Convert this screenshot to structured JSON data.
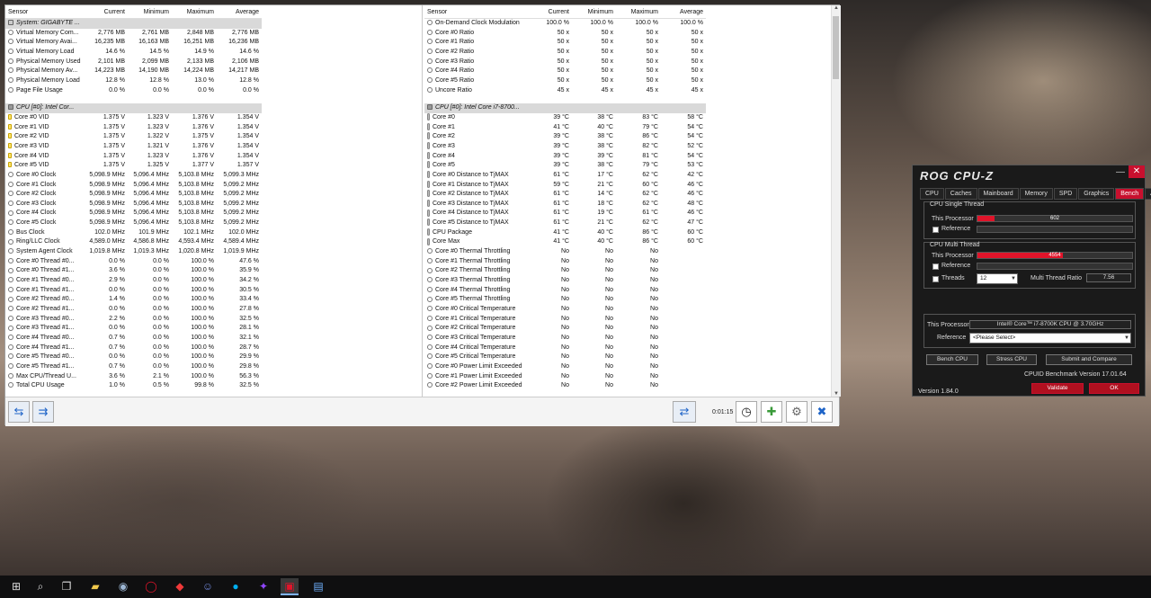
{
  "hwinfo": {
    "columns": [
      "Sensor",
      "Current",
      "Minimum",
      "Maximum",
      "Average"
    ],
    "left_rows": [
      {
        "g": 1,
        "icon": "sys-icon",
        "name": "System: GIGABYTE ..."
      },
      {
        "icon": "circle-icon",
        "name": "Virtual Memory Com...",
        "cur": "2,776 MB",
        "min": "2,761 MB",
        "max": "2,848 MB",
        "avg": "2,776 MB"
      },
      {
        "icon": "circle-icon",
        "name": "Virtual Memory Avai...",
        "cur": "16,235 MB",
        "min": "16,163 MB",
        "max": "16,251 MB",
        "avg": "16,236 MB"
      },
      {
        "icon": "circle-icon",
        "name": "Virtual Memory Load",
        "cur": "14.6 %",
        "min": "14.5 %",
        "max": "14.9 %",
        "avg": "14.6 %"
      },
      {
        "icon": "circle-icon",
        "name": "Physical Memory Used",
        "cur": "2,101 MB",
        "min": "2,099 MB",
        "max": "2,133 MB",
        "avg": "2,106 MB"
      },
      {
        "icon": "circle-icon",
        "name": "Physical Memory Av...",
        "cur": "14,223 MB",
        "min": "14,190 MB",
        "max": "14,224 MB",
        "avg": "14,217 MB"
      },
      {
        "icon": "circle-icon",
        "name": "Physical Memory Load",
        "cur": "12.8 %",
        "min": "12.8 %",
        "max": "13.0 %",
        "avg": "12.8 %"
      },
      {
        "icon": "circle-icon",
        "name": "Page File Usage",
        "cur": "0.0 %",
        "min": "0.0 %",
        "max": "0.0 %",
        "avg": "0.0 %"
      },
      {
        "spacer": 1
      },
      {
        "g": 1,
        "icon": "cpu-icon",
        "name": "CPU [#0]: Intel Cor..."
      },
      {
        "icon": "voltage-icon",
        "name": "Core #0 VID",
        "cur": "1.375 V",
        "min": "1.323 V",
        "max": "1.376 V",
        "avg": "1.354 V"
      },
      {
        "icon": "voltage-icon",
        "name": "Core #1 VID",
        "cur": "1.375 V",
        "min": "1.323 V",
        "max": "1.376 V",
        "avg": "1.354 V"
      },
      {
        "icon": "voltage-icon",
        "name": "Core #2 VID",
        "cur": "1.375 V",
        "min": "1.322 V",
        "max": "1.375 V",
        "avg": "1.354 V"
      },
      {
        "icon": "voltage-icon",
        "name": "Core #3 VID",
        "cur": "1.375 V",
        "min": "1.321 V",
        "max": "1.376 V",
        "avg": "1.354 V"
      },
      {
        "icon": "voltage-icon",
        "name": "Core #4 VID",
        "cur": "1.375 V",
        "min": "1.323 V",
        "max": "1.376 V",
        "avg": "1.354 V"
      },
      {
        "icon": "voltage-icon",
        "name": "Core #5 VID",
        "cur": "1.375 V",
        "min": "1.325 V",
        "max": "1.377 V",
        "avg": "1.357 V"
      },
      {
        "icon": "circle-icon",
        "name": "Core #0 Clock",
        "cur": "5,098.9 MHz",
        "min": "5,096.4 MHz",
        "max": "5,103.8 MHz",
        "avg": "5,099.3 MHz"
      },
      {
        "icon": "circle-icon",
        "name": "Core #1 Clock",
        "cur": "5,098.9 MHz",
        "min": "5,096.4 MHz",
        "max": "5,103.8 MHz",
        "avg": "5,099.2 MHz"
      },
      {
        "icon": "circle-icon",
        "name": "Core #2 Clock",
        "cur": "5,098.9 MHz",
        "min": "5,096.4 MHz",
        "max": "5,103.8 MHz",
        "avg": "5,099.2 MHz"
      },
      {
        "icon": "circle-icon",
        "name": "Core #3 Clock",
        "cur": "5,098.9 MHz",
        "min": "5,096.4 MHz",
        "max": "5,103.8 MHz",
        "avg": "5,099.2 MHz"
      },
      {
        "icon": "circle-icon",
        "name": "Core #4 Clock",
        "cur": "5,098.9 MHz",
        "min": "5,096.4 MHz",
        "max": "5,103.8 MHz",
        "avg": "5,099.2 MHz"
      },
      {
        "icon": "circle-icon",
        "name": "Core #5 Clock",
        "cur": "5,098.9 MHz",
        "min": "5,096.4 MHz",
        "max": "5,103.8 MHz",
        "avg": "5,099.2 MHz"
      },
      {
        "icon": "circle-icon",
        "name": "Bus Clock",
        "cur": "102.0 MHz",
        "min": "101.9 MHz",
        "max": "102.1 MHz",
        "avg": "102.0 MHz"
      },
      {
        "icon": "circle-icon",
        "name": "Ring/LLC Clock",
        "cur": "4,589.0 MHz",
        "min": "4,586.8 MHz",
        "max": "4,593.4 MHz",
        "avg": "4,589.4 MHz"
      },
      {
        "icon": "circle-icon",
        "name": "System Agent Clock",
        "cur": "1,019.8 MHz",
        "min": "1,019.3 MHz",
        "max": "1,020.8 MHz",
        "avg": "1,019.9 MHz"
      },
      {
        "icon": "circle-icon",
        "name": "Core #0 Thread #0...",
        "cur": "0.0 %",
        "min": "0.0 %",
        "max": "100.0 %",
        "avg": "47.6 %"
      },
      {
        "icon": "circle-icon",
        "name": "Core #0 Thread #1...",
        "cur": "3.6 %",
        "min": "0.0 %",
        "max": "100.0 %",
        "avg": "35.9 %"
      },
      {
        "icon": "circle-icon",
        "name": "Core #1 Thread #0...",
        "cur": "2.9 %",
        "min": "0.0 %",
        "max": "100.0 %",
        "avg": "34.2 %"
      },
      {
        "icon": "circle-icon",
        "name": "Core #1 Thread #1...",
        "cur": "0.0 %",
        "min": "0.0 %",
        "max": "100.0 %",
        "avg": "30.5 %"
      },
      {
        "icon": "circle-icon",
        "name": "Core #2 Thread #0...",
        "cur": "1.4 %",
        "min": "0.0 %",
        "max": "100.0 %",
        "avg": "33.4 %"
      },
      {
        "icon": "circle-icon",
        "name": "Core #2 Thread #1...",
        "cur": "0.0 %",
        "min": "0.0 %",
        "max": "100.0 %",
        "avg": "27.8 %"
      },
      {
        "icon": "circle-icon",
        "name": "Core #3 Thread #0...",
        "cur": "2.2 %",
        "min": "0.0 %",
        "max": "100.0 %",
        "avg": "32.5 %"
      },
      {
        "icon": "circle-icon",
        "name": "Core #3 Thread #1...",
        "cur": "0.0 %",
        "min": "0.0 %",
        "max": "100.0 %",
        "avg": "28.1 %"
      },
      {
        "icon": "circle-icon",
        "name": "Core #4 Thread #0...",
        "cur": "0.7 %",
        "min": "0.0 %",
        "max": "100.0 %",
        "avg": "32.1 %"
      },
      {
        "icon": "circle-icon",
        "name": "Core #4 Thread #1...",
        "cur": "0.7 %",
        "min": "0.0 %",
        "max": "100.0 %",
        "avg": "28.7 %"
      },
      {
        "icon": "circle-icon",
        "name": "Core #5 Thread #0...",
        "cur": "0.0 %",
        "min": "0.0 %",
        "max": "100.0 %",
        "avg": "29.9 %"
      },
      {
        "icon": "circle-icon",
        "name": "Core #5 Thread #1...",
        "cur": "0.7 %",
        "min": "0.0 %",
        "max": "100.0 %",
        "avg": "29.8 %"
      },
      {
        "icon": "circle-icon",
        "name": "Max CPU/Thread U...",
        "cur": "3.6 %",
        "min": "2.1 %",
        "max": "100.0 %",
        "avg": "56.3 %"
      },
      {
        "icon": "circle-icon",
        "name": "Total CPU Usage",
        "cur": "1.0 %",
        "min": "0.5 %",
        "max": "99.8 %",
        "avg": "32.5 %"
      }
    ],
    "right_rows": [
      {
        "icon": "circle-icon",
        "name": "On-Demand Clock Modulation",
        "cur": "100.0 %",
        "min": "100.0 %",
        "max": "100.0 %",
        "avg": "100.0 %"
      },
      {
        "icon": "circle-icon",
        "name": "Core #0 Ratio",
        "cur": "50 x",
        "min": "50 x",
        "max": "50 x",
        "avg": "50 x"
      },
      {
        "icon": "circle-icon",
        "name": "Core #1 Ratio",
        "cur": "50 x",
        "min": "50 x",
        "max": "50 x",
        "avg": "50 x"
      },
      {
        "icon": "circle-icon",
        "name": "Core #2 Ratio",
        "cur": "50 x",
        "min": "50 x",
        "max": "50 x",
        "avg": "50 x"
      },
      {
        "icon": "circle-icon",
        "name": "Core #3 Ratio",
        "cur": "50 x",
        "min": "50 x",
        "max": "50 x",
        "avg": "50 x"
      },
      {
        "icon": "circle-icon",
        "name": "Core #4 Ratio",
        "cur": "50 x",
        "min": "50 x",
        "max": "50 x",
        "avg": "50 x"
      },
      {
        "icon": "circle-icon",
        "name": "Core #5 Ratio",
        "cur": "50 x",
        "min": "50 x",
        "max": "50 x",
        "avg": "50 x"
      },
      {
        "icon": "circle-icon",
        "name": "Uncore Ratio",
        "cur": "45 x",
        "min": "45 x",
        "max": "45 x",
        "avg": "45 x"
      },
      {
        "spacer": 1
      },
      {
        "g": 1,
        "icon": "cpu-icon",
        "name": "CPU [#0]: Intel Core i7-8700..."
      },
      {
        "icon": "thermometer-icon",
        "name": "Core #0",
        "cur": "39 °C",
        "min": "38 °C",
        "max": "83 °C",
        "avg": "58 °C"
      },
      {
        "icon": "thermometer-icon",
        "name": "Core #1",
        "cur": "41 °C",
        "min": "40 °C",
        "max": "79 °C",
        "avg": "54 °C"
      },
      {
        "icon": "thermometer-icon",
        "name": "Core #2",
        "cur": "39 °C",
        "min": "38 °C",
        "max": "86 °C",
        "avg": "54 °C"
      },
      {
        "icon": "thermometer-icon",
        "name": "Core #3",
        "cur": "39 °C",
        "min": "38 °C",
        "max": "82 °C",
        "avg": "52 °C"
      },
      {
        "icon": "thermometer-icon",
        "name": "Core #4",
        "cur": "39 °C",
        "min": "39 °C",
        "max": "81 °C",
        "avg": "54 °C"
      },
      {
        "icon": "thermometer-icon",
        "name": "Core #5",
        "cur": "39 °C",
        "min": "38 °C",
        "max": "79 °C",
        "avg": "53 °C"
      },
      {
        "icon": "thermometer-icon",
        "name": "Core #0 Distance to TjMAX",
        "cur": "61 °C",
        "min": "17 °C",
        "max": "62 °C",
        "avg": "42 °C"
      },
      {
        "icon": "thermometer-icon",
        "name": "Core #1 Distance to TjMAX",
        "cur": "59 °C",
        "min": "21 °C",
        "max": "60 °C",
        "avg": "46 °C"
      },
      {
        "icon": "thermometer-icon",
        "name": "Core #2 Distance to TjMAX",
        "cur": "61 °C",
        "min": "14 °C",
        "max": "62 °C",
        "avg": "46 °C"
      },
      {
        "icon": "thermometer-icon",
        "name": "Core #3 Distance to TjMAX",
        "cur": "61 °C",
        "min": "18 °C",
        "max": "62 °C",
        "avg": "48 °C"
      },
      {
        "icon": "thermometer-icon",
        "name": "Core #4 Distance to TjMAX",
        "cur": "61 °C",
        "min": "19 °C",
        "max": "61 °C",
        "avg": "46 °C"
      },
      {
        "icon": "thermometer-icon",
        "name": "Core #5 Distance to TjMAX",
        "cur": "61 °C",
        "min": "21 °C",
        "max": "62 °C",
        "avg": "47 °C"
      },
      {
        "icon": "thermometer-icon",
        "name": "CPU Package",
        "cur": "41 °C",
        "min": "40 °C",
        "max": "86 °C",
        "avg": "60 °C"
      },
      {
        "icon": "thermometer-icon",
        "name": "Core Max",
        "cur": "41 °C",
        "min": "40 °C",
        "max": "86 °C",
        "avg": "60 °C"
      },
      {
        "icon": "circle-icon",
        "name": "Core #0 Thermal Throttling",
        "cur": "No",
        "min": "No",
        "max": "No",
        "avg": ""
      },
      {
        "icon": "circle-icon",
        "name": "Core #1 Thermal Throttling",
        "cur": "No",
        "min": "No",
        "max": "No",
        "avg": ""
      },
      {
        "icon": "circle-icon",
        "name": "Core #2 Thermal Throttling",
        "cur": "No",
        "min": "No",
        "max": "No",
        "avg": ""
      },
      {
        "icon": "circle-icon",
        "name": "Core #3 Thermal Throttling",
        "cur": "No",
        "min": "No",
        "max": "No",
        "avg": ""
      },
      {
        "icon": "circle-icon",
        "name": "Core #4 Thermal Throttling",
        "cur": "No",
        "min": "No",
        "max": "No",
        "avg": ""
      },
      {
        "icon": "circle-icon",
        "name": "Core #5 Thermal Throttling",
        "cur": "No",
        "min": "No",
        "max": "No",
        "avg": ""
      },
      {
        "icon": "circle-icon",
        "name": "Core #0 Critical Temperature",
        "cur": "No",
        "min": "No",
        "max": "No",
        "avg": ""
      },
      {
        "icon": "circle-icon",
        "name": "Core #1 Critical Temperature",
        "cur": "No",
        "min": "No",
        "max": "No",
        "avg": ""
      },
      {
        "icon": "circle-icon",
        "name": "Core #2 Critical Temperature",
        "cur": "No",
        "min": "No",
        "max": "No",
        "avg": ""
      },
      {
        "icon": "circle-icon",
        "name": "Core #3 Critical Temperature",
        "cur": "No",
        "min": "No",
        "max": "No",
        "avg": ""
      },
      {
        "icon": "circle-icon",
        "name": "Core #4 Critical Temperature",
        "cur": "No",
        "min": "No",
        "max": "No",
        "avg": ""
      },
      {
        "icon": "circle-icon",
        "name": "Core #5 Critical Temperature",
        "cur": "No",
        "min": "No",
        "max": "No",
        "avg": ""
      },
      {
        "icon": "circle-icon",
        "name": "Core #0 Power Limit Exceeded",
        "cur": "No",
        "min": "No",
        "max": "No",
        "avg": ""
      },
      {
        "icon": "circle-icon",
        "name": "Core #1 Power Limit Exceeded",
        "cur": "No",
        "min": "No",
        "max": "No",
        "avg": ""
      },
      {
        "icon": "circle-icon",
        "name": "Core #2 Power Limit Exceeded",
        "cur": "No",
        "min": "No",
        "max": "No",
        "avg": ""
      }
    ],
    "toolbar": {
      "timer": "0:01:15"
    }
  },
  "rog": {
    "title": "ROG CPU-Z",
    "tabs": [
      "CPU",
      "Caches",
      "Mainboard",
      "Memory",
      "SPD",
      "Graphics",
      "Bench",
      "About"
    ],
    "active_tab": "Bench",
    "single_thread": {
      "legend": "CPU Single Thread",
      "this_label": "This Processor",
      "this_value": "602",
      "this_fraction": 0.11,
      "ref_label": "Reference"
    },
    "multi_thread": {
      "legend": "CPU Multi Thread",
      "this_label": "This Processor",
      "this_value": "4554",
      "this_fraction": 0.55,
      "ref_label": "Reference",
      "threads_label": "Threads",
      "threads_value": "12",
      "ratio_label": "Multi Thread Ratio",
      "ratio_value": "7.56"
    },
    "processor_label": "This Processor",
    "processor_value": "Intel® Core™ i7-8700K CPU @ 3.70GHz",
    "reference_label": "Reference",
    "reference_value": "<Please Select>",
    "bench_button": "Bench CPU",
    "stress_button": "Stress CPU",
    "submit_button": "Submit and Compare",
    "benchmark_version": "CPUID Benchmark Version 17.01.64",
    "version": "Version 1.84.0",
    "validate_button": "Validate",
    "ok_button": "OK",
    "accent_color": "#c8102e"
  },
  "taskbar": {
    "icons": [
      "windows-start-icon",
      "search-icon",
      "task-view-icon",
      "file-explorer-icon",
      "steam-icon",
      "opera-icon",
      "vivaldi-icon",
      "discord-icon",
      "skype-icon",
      "twitch-icon",
      "rog-cpuz-icon",
      "hwinfo-icon"
    ]
  }
}
